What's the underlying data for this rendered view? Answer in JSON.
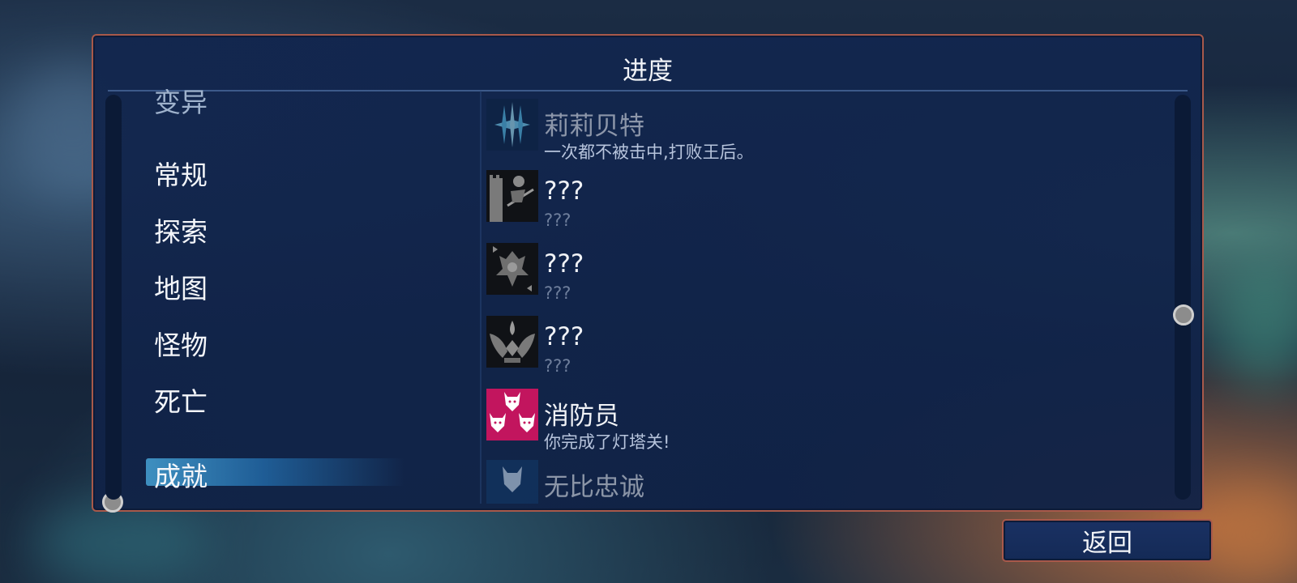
{
  "panel": {
    "title": "进度"
  },
  "categories": [
    {
      "label": "变异",
      "partial": true
    },
    {
      "label": "常规"
    },
    {
      "label": "探索"
    },
    {
      "label": "地图"
    },
    {
      "label": "怪物"
    },
    {
      "label": "死亡"
    },
    {
      "label": "成就",
      "selected": true
    }
  ],
  "achievements": [
    {
      "title": "莉莉贝特",
      "description": "一次都不被击中,打败王后。",
      "icon": "blue-crystal-spikes-icon",
      "state": "unlocked-partial"
    },
    {
      "title": "???",
      "description": "???",
      "icon": "tower-knight-icon",
      "state": "locked"
    },
    {
      "title": "???",
      "description": "???",
      "icon": "queen-card-icon",
      "state": "locked"
    },
    {
      "title": "???",
      "description": "???",
      "icon": "winged-crest-icon",
      "state": "locked"
    },
    {
      "title": "消防员",
      "description": "你完成了灯塔关!",
      "icon": "pink-fox-masks-icon",
      "state": "unlocked"
    },
    {
      "title": "无比忠诚",
      "description": "",
      "icon": "blue-fox-mask-icon",
      "state": "unlocked-partial"
    }
  ],
  "footer": {
    "back_label": "返回"
  },
  "colors": {
    "panel_border": "#a8594a",
    "panel_bg": "#12264e",
    "selected_gradient": "#3e8fc0",
    "pink_icon": "#c2155e"
  }
}
